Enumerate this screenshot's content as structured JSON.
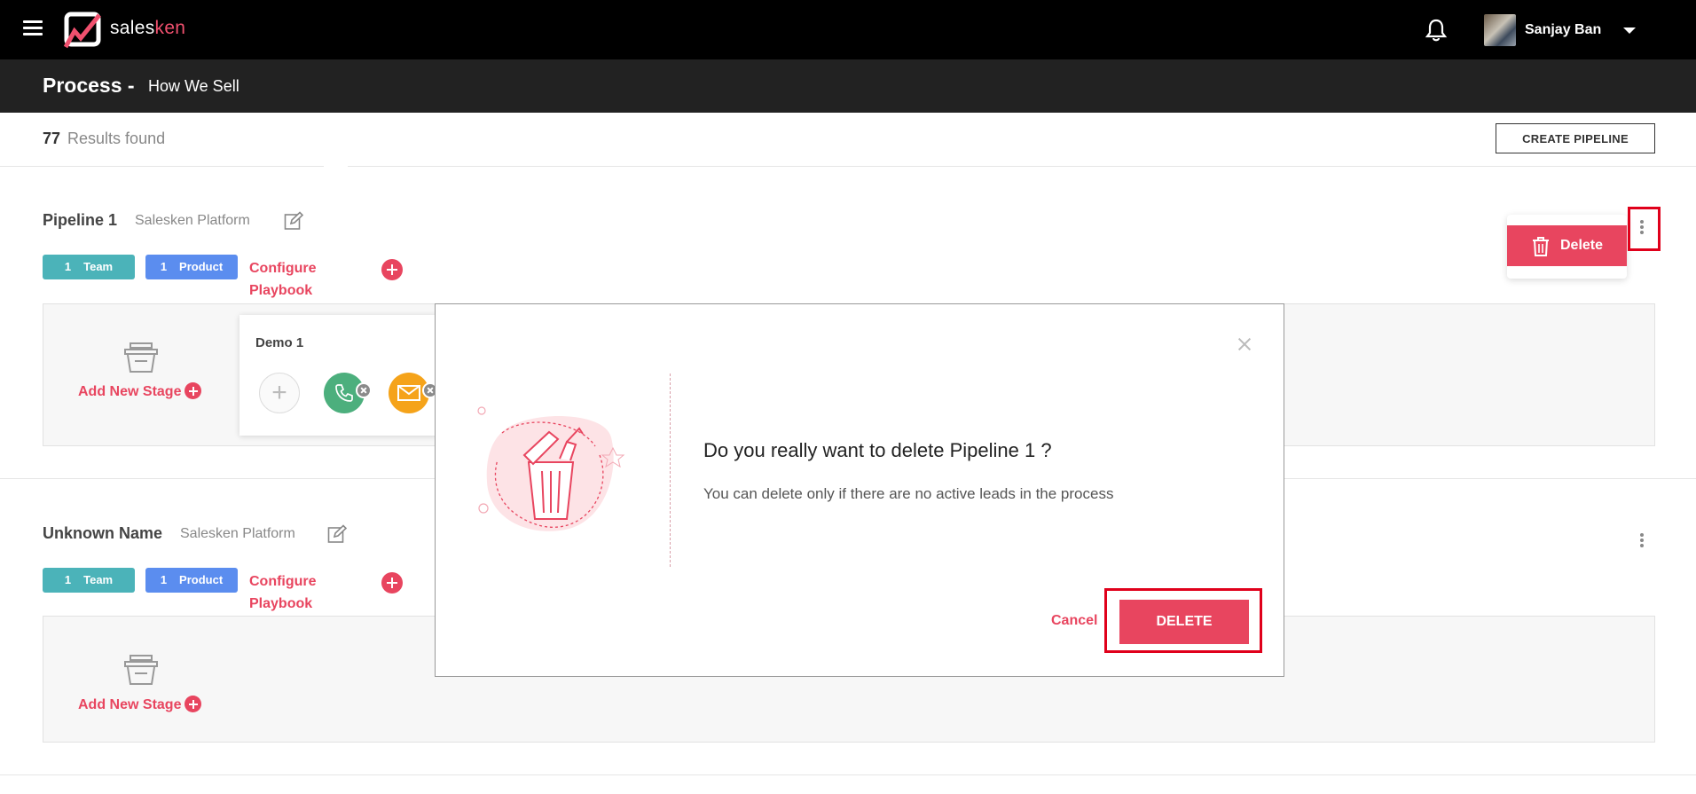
{
  "header": {
    "brand_prefix": "sales",
    "brand_suffix": "ken",
    "user_name": "Sanjay Ban",
    "icons": {
      "menu": "hamburger-icon",
      "notifications": "bell-icon",
      "dropdown": "caret-down-icon"
    }
  },
  "subheader": {
    "title": "Process -",
    "name": "How We Sell"
  },
  "toolbar": {
    "count": "77",
    "results_label": "Results found",
    "create_label": "CREATE PIPELINE"
  },
  "pipelines": [
    {
      "name": "Pipeline 1",
      "platform": "Salesken Platform",
      "team_count": "1",
      "team_label": "Team",
      "product_count": "1",
      "product_label": "Product",
      "configure_line1": "Configure",
      "configure_line2": "Playbook",
      "add_stage": "Add New Stage",
      "stage": {
        "title": "Demo 1",
        "add_glyph": "+"
      }
    },
    {
      "name": "Unknown Name",
      "platform": "Salesken Platform",
      "team_count": "1",
      "team_label": "Team",
      "product_count": "1",
      "product_label": "Product",
      "configure_line1": "Configure",
      "configure_line2": "Playbook",
      "add_stage": "Add New Stage"
    }
  ],
  "context_menu": {
    "delete_label": "Delete"
  },
  "modal": {
    "title": "Do you really want to delete Pipeline 1 ?",
    "message": "You can delete only if there are no active leads in the process",
    "cancel_label": "Cancel",
    "delete_label": "DELETE"
  },
  "colors": {
    "accent": "#e8455f",
    "team": "#4bb3b9",
    "product": "#5b8def",
    "call": "#4caf7d",
    "mail": "#f5a31a",
    "topbar": "#000000",
    "subbar": "#222222"
  }
}
